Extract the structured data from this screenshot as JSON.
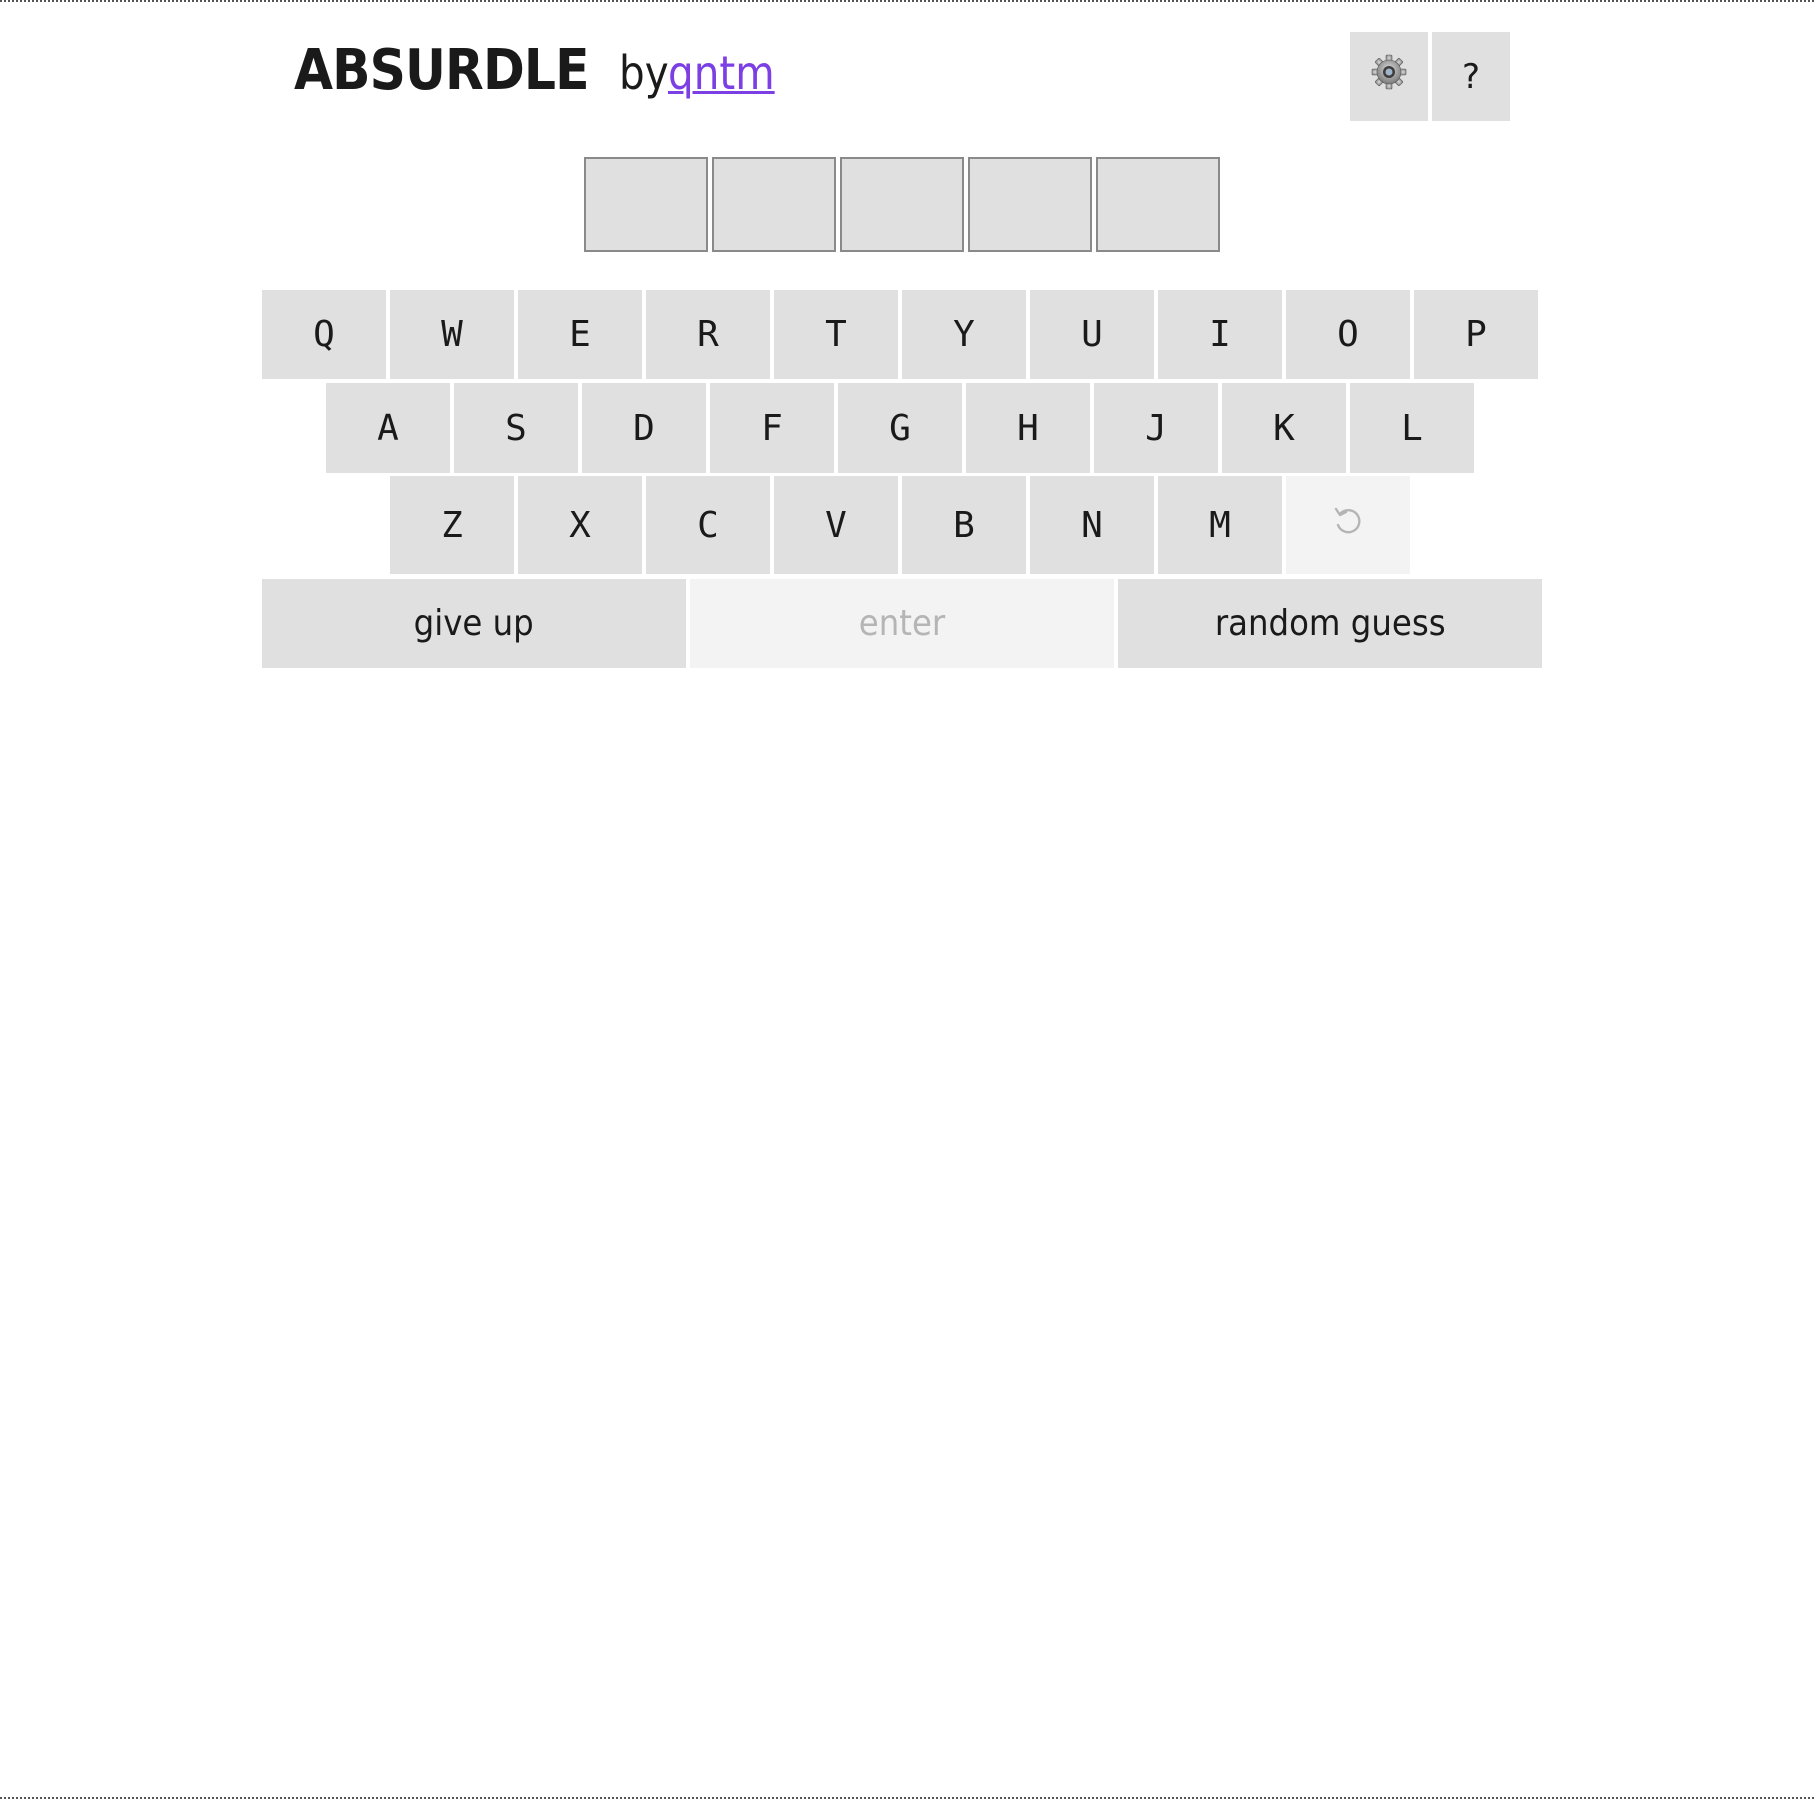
{
  "header": {
    "title": "ABSURDLE",
    "by": "by",
    "author_link": "qntm"
  },
  "toolbar": {
    "settings_icon": "gear-icon",
    "help_label": "?"
  },
  "guess_row": {
    "cells": [
      "",
      "",
      "",
      "",
      ""
    ]
  },
  "keyboard": {
    "row1": [
      "Q",
      "W",
      "E",
      "R",
      "T",
      "Y",
      "U",
      "I",
      "O",
      "P"
    ],
    "row2": [
      "A",
      "S",
      "D",
      "F",
      "G",
      "H",
      "J",
      "K",
      "L"
    ],
    "row3": [
      "Z",
      "X",
      "C",
      "V",
      "B",
      "N",
      "M"
    ],
    "backspace_icon": "undo-arrow-icon",
    "backspace_enabled": false
  },
  "actions": {
    "give_up": "give up",
    "enter": "enter",
    "enter_enabled": false,
    "random_guess": "random guess"
  },
  "colors": {
    "key_background": "#e0e0e0",
    "disabled_background": "#f3f3f3",
    "disabled_text": "#b5b5b5",
    "link": "#7b3fe4"
  }
}
